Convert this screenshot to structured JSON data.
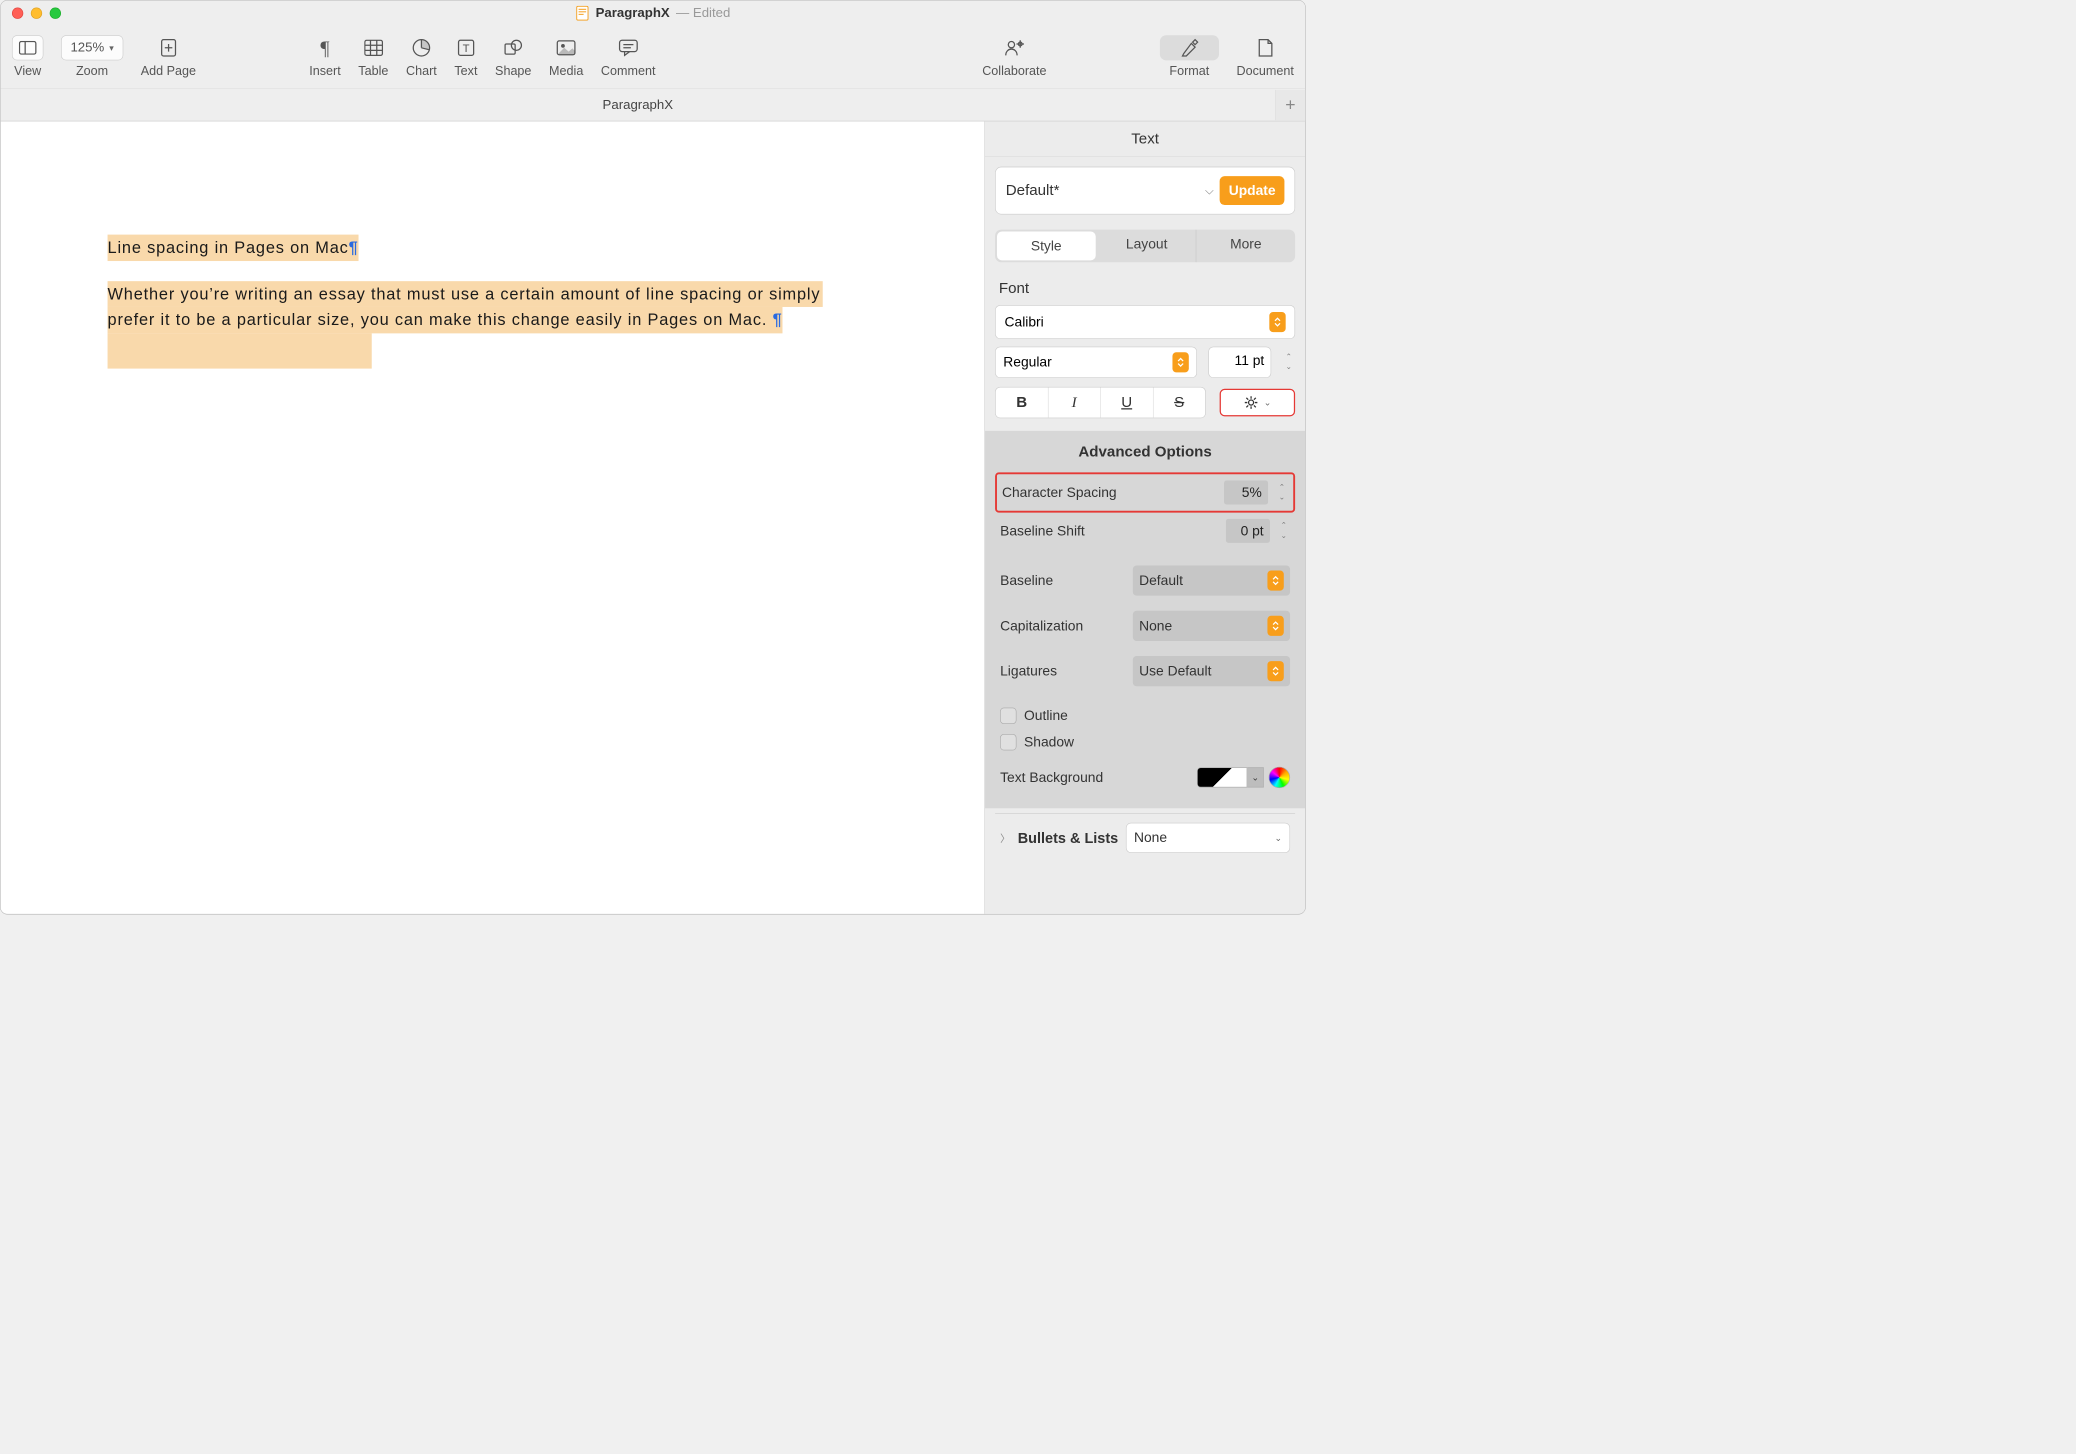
{
  "titlebar": {
    "doc_name": "ParagraphX",
    "status": "— Edited"
  },
  "toolbar": {
    "view": "View",
    "zoom_value": "125%",
    "zoom": "Zoom",
    "add_page": "Add Page",
    "insert": "Insert",
    "table": "Table",
    "chart": "Chart",
    "text": "Text",
    "shape": "Shape",
    "media": "Media",
    "comment": "Comment",
    "collaborate": "Collaborate",
    "format": "Format",
    "document": "Document"
  },
  "tabrow": {
    "name": "ParagraphX"
  },
  "document": {
    "line1": "Line spacing in Pages on Mac",
    "para2_a": "Whether you’re writing an essay that must use a certain amount of line spacing or simply ",
    "para2_b": "prefer it to be a particular size, you can make this change easily in Pages on Mac. "
  },
  "inspector": {
    "header": "Text",
    "style_name": "Default*",
    "update": "Update",
    "segments": {
      "style": "Style",
      "layout": "Layout",
      "more": "More"
    },
    "font_label": "Font",
    "font_family": "Calibri",
    "font_weight": "Regular",
    "font_size": "11 pt",
    "advanced": {
      "title": "Advanced Options",
      "char_spacing_label": "Character Spacing",
      "char_spacing_value": "5%",
      "baseline_shift_label": "Baseline Shift",
      "baseline_shift_value": "0 pt",
      "baseline_label": "Baseline",
      "baseline_value": "Default",
      "caps_label": "Capitalization",
      "caps_value": "None",
      "ligatures_label": "Ligatures",
      "ligatures_value": "Use Default",
      "outline": "Outline",
      "shadow": "Shadow",
      "text_bg": "Text Background"
    },
    "bullets": {
      "label": "Bullets & Lists",
      "value": "None"
    }
  }
}
